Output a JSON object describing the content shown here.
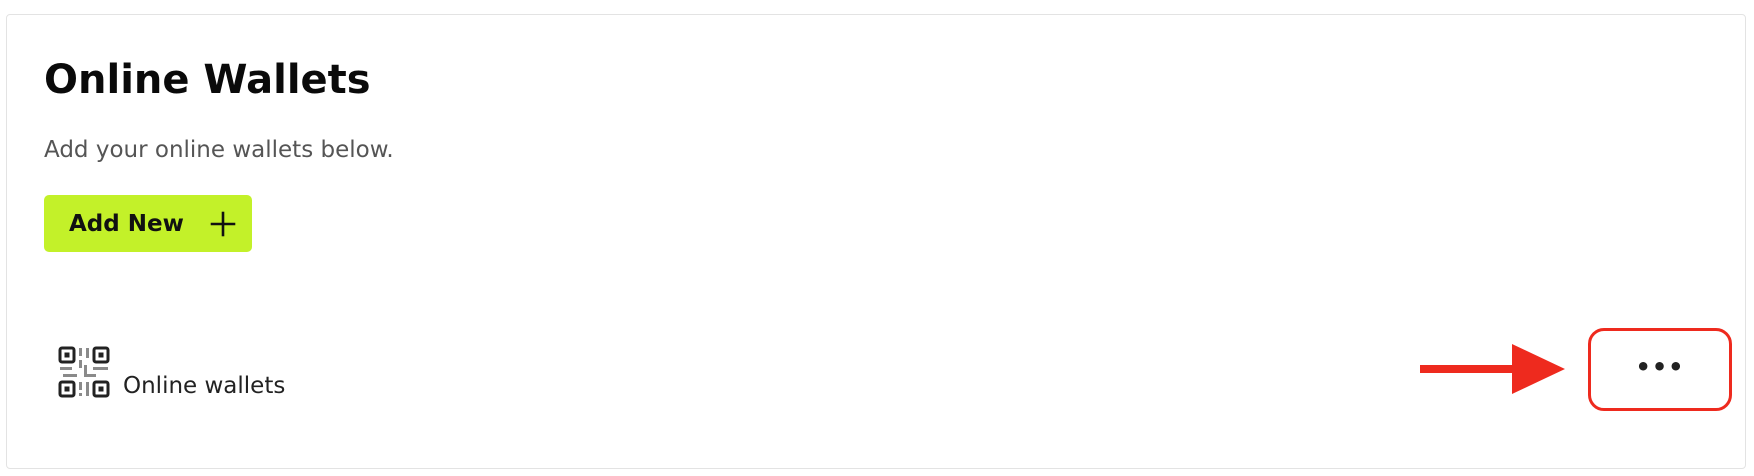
{
  "section": {
    "title": "Online Wallets",
    "subtitle": "Add your online wallets below."
  },
  "add_button": {
    "label": "Add New",
    "icon": "plus-icon"
  },
  "wallet_item": {
    "icon": "qr-code-icon",
    "label": "Online wallets"
  },
  "more_button": {
    "label": "•••",
    "icon": "more-options-icon"
  },
  "annotation": {
    "icon": "arrow-right-icon",
    "color": "#ee2a1e"
  },
  "colors": {
    "accent": "#c3f129",
    "annotation_red": "#ee2a1e",
    "title_text": "#0a0a0a",
    "subtitle_text": "#555555"
  }
}
